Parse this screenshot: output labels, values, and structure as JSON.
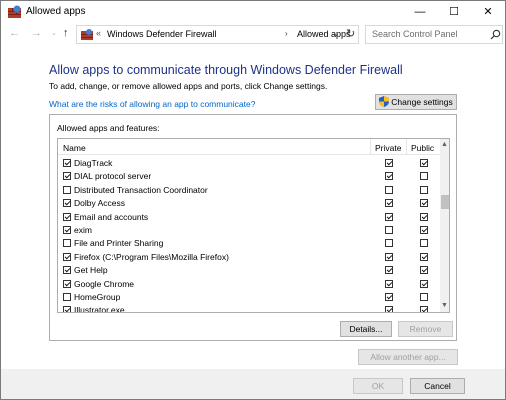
{
  "window": {
    "title": "Allowed apps",
    "minimize": "—",
    "maximize": "☐",
    "close": "✕"
  },
  "nav": {
    "back": "←",
    "forward": "→",
    "dropdown": "⌄",
    "up": "↑"
  },
  "address": {
    "separator": "«",
    "crumbs": [
      "Windows Defender Firewall",
      "Allowed apps"
    ],
    "crumb_arrow": "›",
    "dropdown": "⌄",
    "refresh": "↻"
  },
  "search": {
    "placeholder": "Search Control Panel",
    "icon": "search-icon"
  },
  "content": {
    "heading": "Allow apps to communicate through Windows Defender Firewall",
    "subtext": "To add, change, or remove allowed apps and ports, click Change settings.",
    "risk_link": "What are the risks of allowing an app to communicate?",
    "change_settings": "Change settings"
  },
  "panel": {
    "label": "Allowed apps and features:",
    "columns": {
      "name": "Name",
      "private": "Private",
      "public": "Public"
    },
    "rows": [
      {
        "name": "DiagTrack",
        "enabled": true,
        "private": true,
        "public": true
      },
      {
        "name": "DIAL protocol server",
        "enabled": true,
        "private": true,
        "public": false
      },
      {
        "name": "Distributed Transaction Coordinator",
        "enabled": false,
        "private": false,
        "public": false
      },
      {
        "name": "Dolby Access",
        "enabled": true,
        "private": true,
        "public": true
      },
      {
        "name": "Email and accounts",
        "enabled": true,
        "private": true,
        "public": true
      },
      {
        "name": "exim",
        "enabled": true,
        "private": false,
        "public": true
      },
      {
        "name": "File and Printer Sharing",
        "enabled": false,
        "private": false,
        "public": false
      },
      {
        "name": "Firefox (C:\\Program Files\\Mozilla Firefox)",
        "enabled": true,
        "private": true,
        "public": true
      },
      {
        "name": "Get Help",
        "enabled": true,
        "private": true,
        "public": true
      },
      {
        "name": "Google Chrome",
        "enabled": true,
        "private": true,
        "public": true
      },
      {
        "name": "HomeGroup",
        "enabled": false,
        "private": true,
        "public": false
      },
      {
        "name": "Illustrator.exe",
        "enabled": true,
        "private": true,
        "public": true
      }
    ],
    "scroll_up": "▲",
    "scroll_down": "▼",
    "details": "Details...",
    "remove": "Remove"
  },
  "buttons": {
    "allow_another": "Allow another app...",
    "ok": "OK",
    "cancel": "Cancel"
  },
  "colors": {
    "heading": "#1e3287",
    "link": "#0066cc",
    "button_bg": "#e1e1e1",
    "disabled_text": "#a0a0a0"
  }
}
